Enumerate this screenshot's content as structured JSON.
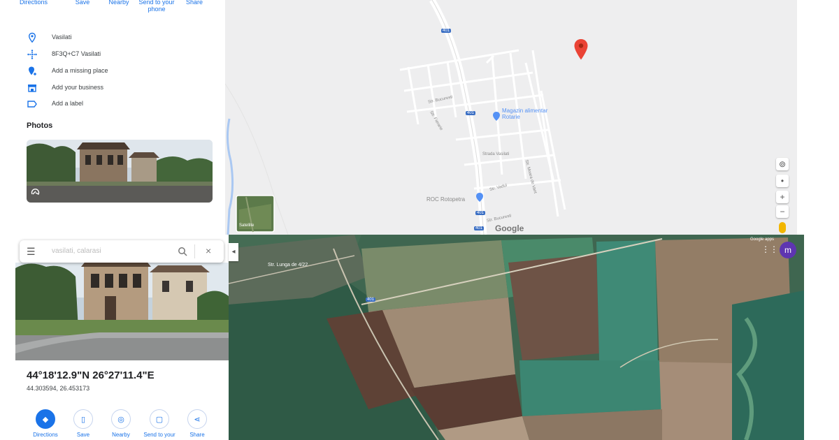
{
  "top_panel": {
    "actions": [
      "Directions",
      "Save",
      "Nearby",
      "Send to your phone",
      "Share"
    ],
    "info": [
      {
        "icon": "location-pin-icon",
        "text": "Vasilati"
      },
      {
        "icon": "plus-code-icon",
        "text": "8F3Q+C7 Vasilati"
      },
      {
        "icon": "add-place-icon",
        "text": "Add a missing place"
      },
      {
        "icon": "business-icon",
        "text": "Add your business"
      },
      {
        "icon": "label-icon",
        "text": "Add a label"
      }
    ],
    "photos_heading": "Photos"
  },
  "top_map": {
    "road_shields": [
      "401",
      "401",
      "401",
      "401"
    ],
    "street_labels": [
      "Str. Bucuresti",
      "Str. Fierarie",
      "Strada Vasilati",
      "Str. Moara de Vant",
      "Str. Vadul",
      "Str. Bucuresti"
    ],
    "pois": [
      {
        "name": "Magazin alimentar Rotarie"
      },
      {
        "name": "ROC Rotopetra"
      }
    ],
    "satellite_label": "Satellite",
    "logo": "Google"
  },
  "bottom_panel": {
    "search_placeholder": "vasilati, calarasi",
    "coord_dms": "44°18'12.9\"N 26°27'11.4\"E",
    "coord_decimal": "44.303594, 26.453173",
    "actions": [
      "Directions",
      "Save",
      "Nearby",
      "Send to your",
      "Share"
    ]
  },
  "satellite_map": {
    "village_label": "Str. Lunga de 4/22",
    "road_shield": "401",
    "top_right_label": "Google apps",
    "avatar_letter": "m"
  },
  "colors": {
    "accent": "#1a73e8",
    "map_background": "#eeeeef",
    "pin": "#ea4335",
    "avatar": "#5e35b1"
  }
}
